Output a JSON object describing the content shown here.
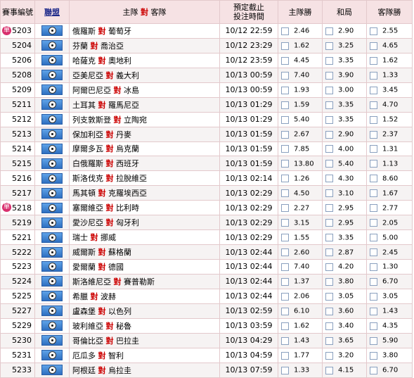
{
  "header": {
    "id_label": "賽事編號",
    "league_label": "聯盟",
    "match_label_home": "主隊",
    "match_label_vs": "對",
    "match_label_away": "客隊",
    "time_label_1": "預定截止",
    "time_label_2": "投注時間",
    "home_win_label": "主隊勝",
    "draw_label": "和局",
    "away_win_label": "客隊勝"
  },
  "single_badge": "單",
  "vs_text": "對",
  "rows": [
    {
      "id": "5203",
      "single": true,
      "home": "俄羅斯",
      "away": "葡萄牙",
      "time": "10/12 22:59",
      "home_odd": "2.46",
      "draw_odd": "2.90",
      "away_odd": "2.55"
    },
    {
      "id": "5204",
      "single": false,
      "home": "芬蘭",
      "away": "喬治亞",
      "time": "10/12 23:29",
      "home_odd": "1.62",
      "draw_odd": "3.25",
      "away_odd": "4.65"
    },
    {
      "id": "5206",
      "single": false,
      "home": "哈薩克",
      "away": "奧地利",
      "time": "10/12 23:59",
      "home_odd": "4.45",
      "draw_odd": "3.35",
      "away_odd": "1.62"
    },
    {
      "id": "5208",
      "single": false,
      "home": "亞美尼亞",
      "away": "義大利",
      "time": "10/13 00:59",
      "home_odd": "7.40",
      "draw_odd": "3.90",
      "away_odd": "1.33"
    },
    {
      "id": "5209",
      "single": false,
      "home": "阿爾巴尼亞",
      "away": "冰島",
      "time": "10/13 00:59",
      "home_odd": "1.93",
      "draw_odd": "3.00",
      "away_odd": "3.45"
    },
    {
      "id": "5211",
      "single": false,
      "home": "土耳其",
      "away": "羅馬尼亞",
      "time": "10/13 01:29",
      "home_odd": "1.59",
      "draw_odd": "3.35",
      "away_odd": "4.70"
    },
    {
      "id": "5212",
      "single": false,
      "home": "列支敦斯登",
      "away": "立陶宛",
      "time": "10/13 01:29",
      "home_odd": "5.40",
      "draw_odd": "3.35",
      "away_odd": "1.52"
    },
    {
      "id": "5213",
      "single": false,
      "home": "保加利亞",
      "away": "丹麥",
      "time": "10/13 01:59",
      "home_odd": "2.67",
      "draw_odd": "2.90",
      "away_odd": "2.37"
    },
    {
      "id": "5214",
      "single": false,
      "home": "摩爾多瓦",
      "away": "烏克蘭",
      "time": "10/13 01:59",
      "home_odd": "7.85",
      "draw_odd": "4.00",
      "away_odd": "1.31"
    },
    {
      "id": "5215",
      "single": false,
      "home": "白俄羅斯",
      "away": "西班牙",
      "time": "10/13 01:59",
      "home_odd": "13.80",
      "draw_odd": "5.40",
      "away_odd": "1.13"
    },
    {
      "id": "5216",
      "single": false,
      "home": "斯洛伐克",
      "away": "拉脫維亞",
      "time": "10/13 02:14",
      "home_odd": "1.26",
      "draw_odd": "4.30",
      "away_odd": "8.60"
    },
    {
      "id": "5217",
      "single": false,
      "home": "馬其頓",
      "away": "克羅埃西亞",
      "time": "10/13 02:29",
      "home_odd": "4.50",
      "draw_odd": "3.10",
      "away_odd": "1.67"
    },
    {
      "id": "5218",
      "single": true,
      "home": "塞爾維亞",
      "away": "比利時",
      "time": "10/13 02:29",
      "home_odd": "2.27",
      "draw_odd": "2.95",
      "away_odd": "2.77"
    },
    {
      "id": "5219",
      "single": false,
      "home": "愛沙尼亞",
      "away": "匈牙利",
      "time": "10/13 02:29",
      "home_odd": "3.15",
      "draw_odd": "2.95",
      "away_odd": "2.05"
    },
    {
      "id": "5221",
      "single": false,
      "home": "瑞士",
      "away": "挪威",
      "time": "10/13 02:29",
      "home_odd": "1.55",
      "draw_odd": "3.35",
      "away_odd": "5.00"
    },
    {
      "id": "5222",
      "single": false,
      "home": "威爾斯",
      "away": "蘇格蘭",
      "time": "10/13 02:44",
      "home_odd": "2.60",
      "draw_odd": "2.87",
      "away_odd": "2.45"
    },
    {
      "id": "5223",
      "single": false,
      "home": "愛爾蘭",
      "away": "德國",
      "time": "10/13 02:44",
      "home_odd": "7.40",
      "draw_odd": "4.20",
      "away_odd": "1.30"
    },
    {
      "id": "5224",
      "single": false,
      "home": "斯洛維尼亞",
      "away": "賽普勒斯",
      "time": "10/13 02:44",
      "home_odd": "1.37",
      "draw_odd": "3.80",
      "away_odd": "6.70"
    },
    {
      "id": "5225",
      "single": false,
      "home": "希臘",
      "away": "波赫",
      "time": "10/13 02:44",
      "home_odd": "2.06",
      "draw_odd": "3.05",
      "away_odd": "3.05"
    },
    {
      "id": "5227",
      "single": false,
      "home": "盧森堡",
      "away": "以色列",
      "time": "10/13 02:59",
      "home_odd": "6.10",
      "draw_odd": "3.60",
      "away_odd": "1.43"
    },
    {
      "id": "5229",
      "single": false,
      "home": "玻利維亞",
      "away": "秘魯",
      "time": "10/13 03:59",
      "home_odd": "1.62",
      "draw_odd": "3.40",
      "away_odd": "4.35"
    },
    {
      "id": "5230",
      "single": false,
      "home": "哥倫比亞",
      "away": "巴拉圭",
      "time": "10/13 04:29",
      "home_odd": "1.43",
      "draw_odd": "3.65",
      "away_odd": "5.90"
    },
    {
      "id": "5231",
      "single": false,
      "home": "厄瓜多",
      "away": "智利",
      "time": "10/13 04:59",
      "home_odd": "1.77",
      "draw_odd": "3.20",
      "away_odd": "3.80"
    },
    {
      "id": "5233",
      "single": false,
      "home": "阿根廷",
      "away": "烏拉圭",
      "time": "10/13 07:59",
      "home_odd": "1.33",
      "draw_odd": "4.15",
      "away_odd": "6.70"
    }
  ]
}
